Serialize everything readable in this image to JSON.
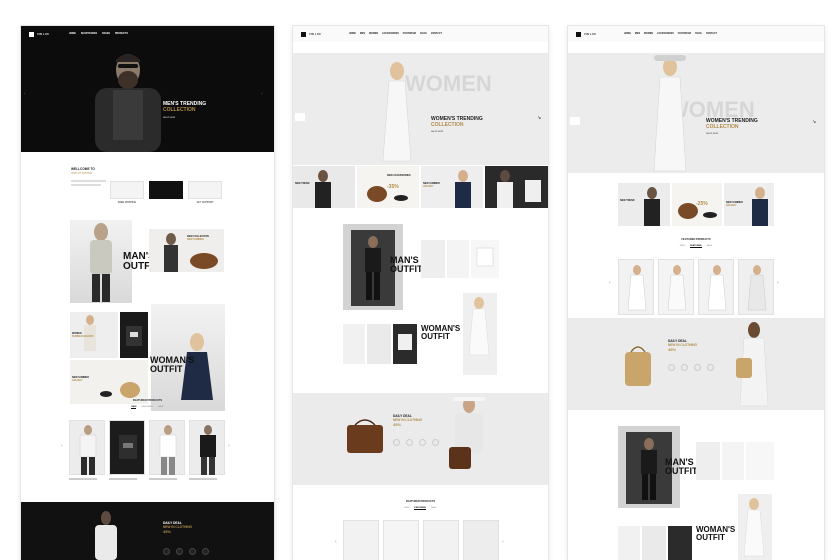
{
  "colors": {
    "accent": "#b08d4a",
    "dark": "#111111",
    "hero_light": "#ececec",
    "section_gray": "#ebebeb"
  },
  "mockup1": {
    "nav": {
      "brand": "VIN LUX",
      "menu": [
        "HOME",
        "SHORTCODES",
        "PAGES",
        "PRODUCTS"
      ]
    },
    "hero": {
      "title_line1": "MEN'S TRENDING",
      "title_line2": "COLLECTION",
      "link": "SHOP NOW"
    },
    "welcome": {
      "title_line1": "WELLCOME TO",
      "title_line2": "VINTLUX FASHION",
      "features": [
        "FREE SHIPPING",
        "MONEY BACK",
        "24/7 SUPPORT"
      ]
    },
    "mans_outfit": {
      "line1": "MAN'S",
      "line2": "OUTFIT",
      "badge_line1": "NEW COLLECTION",
      "badge_line2": "NEW SUMMER"
    },
    "womans_outfit": {
      "line1": "WOMAN'S",
      "line2": "OUTFIT",
      "promo1_line1": "WOMEN",
      "promo1_line2": "SUMMER HOLIDAY",
      "promo2_line1": "NEW SUMMER",
      "promo2_line2": "HOLIDAY"
    },
    "featured": {
      "title": "FEATURED PRODUCTS",
      "tabs": [
        "NEW",
        "FEATURED",
        "SALE"
      ]
    },
    "daily": {
      "line1": "DAILY DEAL",
      "line2": "NEW IN CLOTHING",
      "discount": "45%"
    }
  },
  "mockup2": {
    "nav": {
      "brand": "VIN LUX",
      "menu": [
        "HOME",
        "MEN",
        "WOMEN",
        "ACCESSORIES",
        "FOOTWEAR",
        "BLOG",
        "CONTACT"
      ]
    },
    "hero": {
      "ghost": "WOMEN",
      "title_line1": "WOMEN'S TRENDING",
      "title_line2": "COLLECTION",
      "link": "SHOP NOW"
    },
    "promos": {
      "discount": "-35%",
      "label1": "NEW TREND",
      "label2": "NEW ACCESSORIES",
      "label3": "NEW SUMMER",
      "label4": "HOLIDAY"
    },
    "mans": {
      "line1": "MAN'S",
      "line2": "OUTFIT"
    },
    "womans": {
      "line1": "WOMAN'S",
      "line2": "OUTFIT"
    },
    "daily": {
      "line1": "DAILY DEAL",
      "line2": "NEW IN CLOTHING",
      "discount": "45%"
    },
    "featured": {
      "title": "FEATURED PRODUCTS",
      "tabs": [
        "NEW",
        "FEATURED",
        "SALE"
      ]
    }
  },
  "mockup3": {
    "nav": {
      "brand": "VIN LUX",
      "menu": [
        "HOME",
        "MEN",
        "WOMEN",
        "ACCESSORIES",
        "FOOTWEAR",
        "BLOG",
        "CONTACT"
      ]
    },
    "hero": {
      "ghost": "WOMEN",
      "title_line1": "WOMEN'S TRENDING",
      "title_line2": "COLLECTION",
      "link": "SHOP NOW"
    },
    "promos": {
      "discount": "-25%",
      "label1": "NEW TREND",
      "label2": "NEW SUMMER",
      "label3": "HOLIDAY"
    },
    "featured": {
      "title": "FEATURED PRODUCTS",
      "tabs": [
        "NEW",
        "FEATURED",
        "SALE"
      ]
    },
    "daily": {
      "line1": "DAILY DEAL",
      "line2": "NEW IN CLOTHING",
      "discount": "45%"
    },
    "mans": {
      "line1": "MAN'S",
      "line2": "OUTFIT"
    },
    "womans": {
      "line1": "WOMAN'S",
      "line2": "OUTFIT"
    }
  }
}
